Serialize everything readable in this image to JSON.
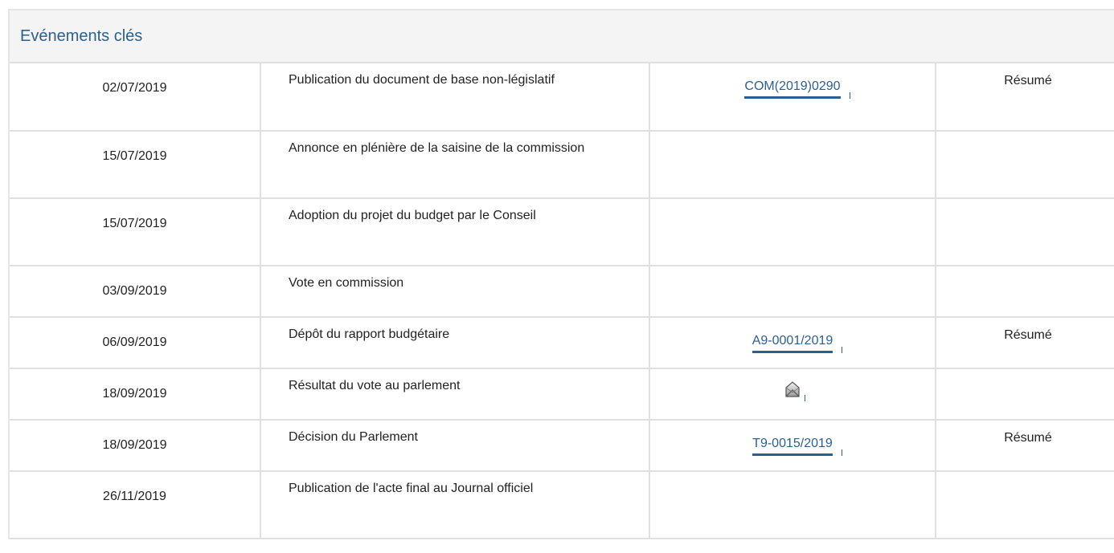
{
  "panel": {
    "title": "Evénements clés"
  },
  "events": [
    {
      "date": "02/07/2019",
      "event": "Publication du document de base non-législatif",
      "document": "COM(2019)0290",
      "summary": "Résumé"
    },
    {
      "date": "15/07/2019",
      "event": "Annonce en plénière de la saisine de la commission",
      "document": "",
      "summary": ""
    },
    {
      "date": "15/07/2019",
      "event": "Adoption du projet du budget par le Conseil",
      "document": "",
      "summary": ""
    },
    {
      "date": "03/09/2019",
      "event": "Vote en commission",
      "document": "",
      "summary": ""
    },
    {
      "date": "06/09/2019",
      "event": "Dépôt du rapport budgétaire",
      "document": "A9-0001/2019",
      "summary": "Résumé"
    },
    {
      "date": "18/09/2019",
      "event": "Résultat du vote au parlement",
      "document": "",
      "document_icon": "vote-result-icon",
      "summary": ""
    },
    {
      "date": "18/09/2019",
      "event": "Décision du Parlement",
      "document": "T9-0015/2019",
      "summary": "Résumé"
    },
    {
      "date": "26/11/2019",
      "event": "Publication de l'acte final au Journal officiel",
      "document": "",
      "summary": ""
    }
  ],
  "colors": {
    "link": "#2c5f8f",
    "header_bg": "#f4f4f4",
    "border": "#e0e0e0"
  }
}
